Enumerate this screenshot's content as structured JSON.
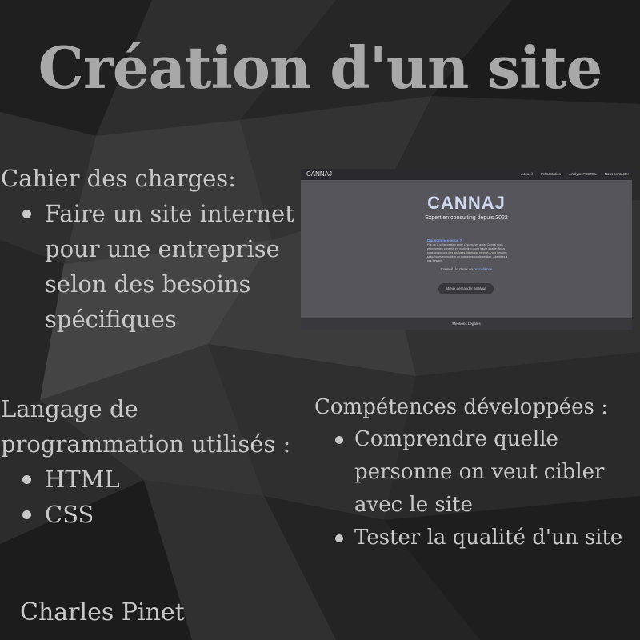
{
  "title": "Création d'un site",
  "cahier": {
    "heading": "Cahier des charges:",
    "items": [
      "Faire un site internet pour une entreprise selon des besoins spécifiques"
    ]
  },
  "langage": {
    "heading": "Langage de programmation utilisés :",
    "items": [
      "HTML",
      "CSS"
    ]
  },
  "competences": {
    "heading": "Compétences développées :",
    "items": [
      "Comprendre quelle personne on veut cibler avec le site",
      "Tester la qualité d'un site"
    ]
  },
  "author": "Charles Pinet",
  "screenshot": {
    "logo": "CANNAJ",
    "nav": [
      "Accueil",
      "Présentation",
      "Analyse PESTEL",
      "Nous contacter"
    ],
    "brand": "CANNAJ",
    "tagline": "Expert en consulting depuis 2022",
    "who_heading": "Qui sommes-nous ?",
    "paragraph": "Fils de la collaboration entre cinq jeunes amis, Cannaj vous propose des conseils en marketing d'une haute qualité. Nous vous proposons des analyses, faites par rapport à vos besoins spécifiques en matière de marketing ou de gestion, adaptées à vos besoins.",
    "note": "Conseil : le choix de",
    "note_link": "l'excellence",
    "button": "Mieux demander analyse",
    "footer": "Mentions Légales"
  },
  "colors": {
    "background": "#2a2a2a",
    "title": "#a8a8a8",
    "text": "#c8c8c8",
    "screenshot_bg": "#56555b",
    "brand_accent": "#cfd8f0"
  }
}
